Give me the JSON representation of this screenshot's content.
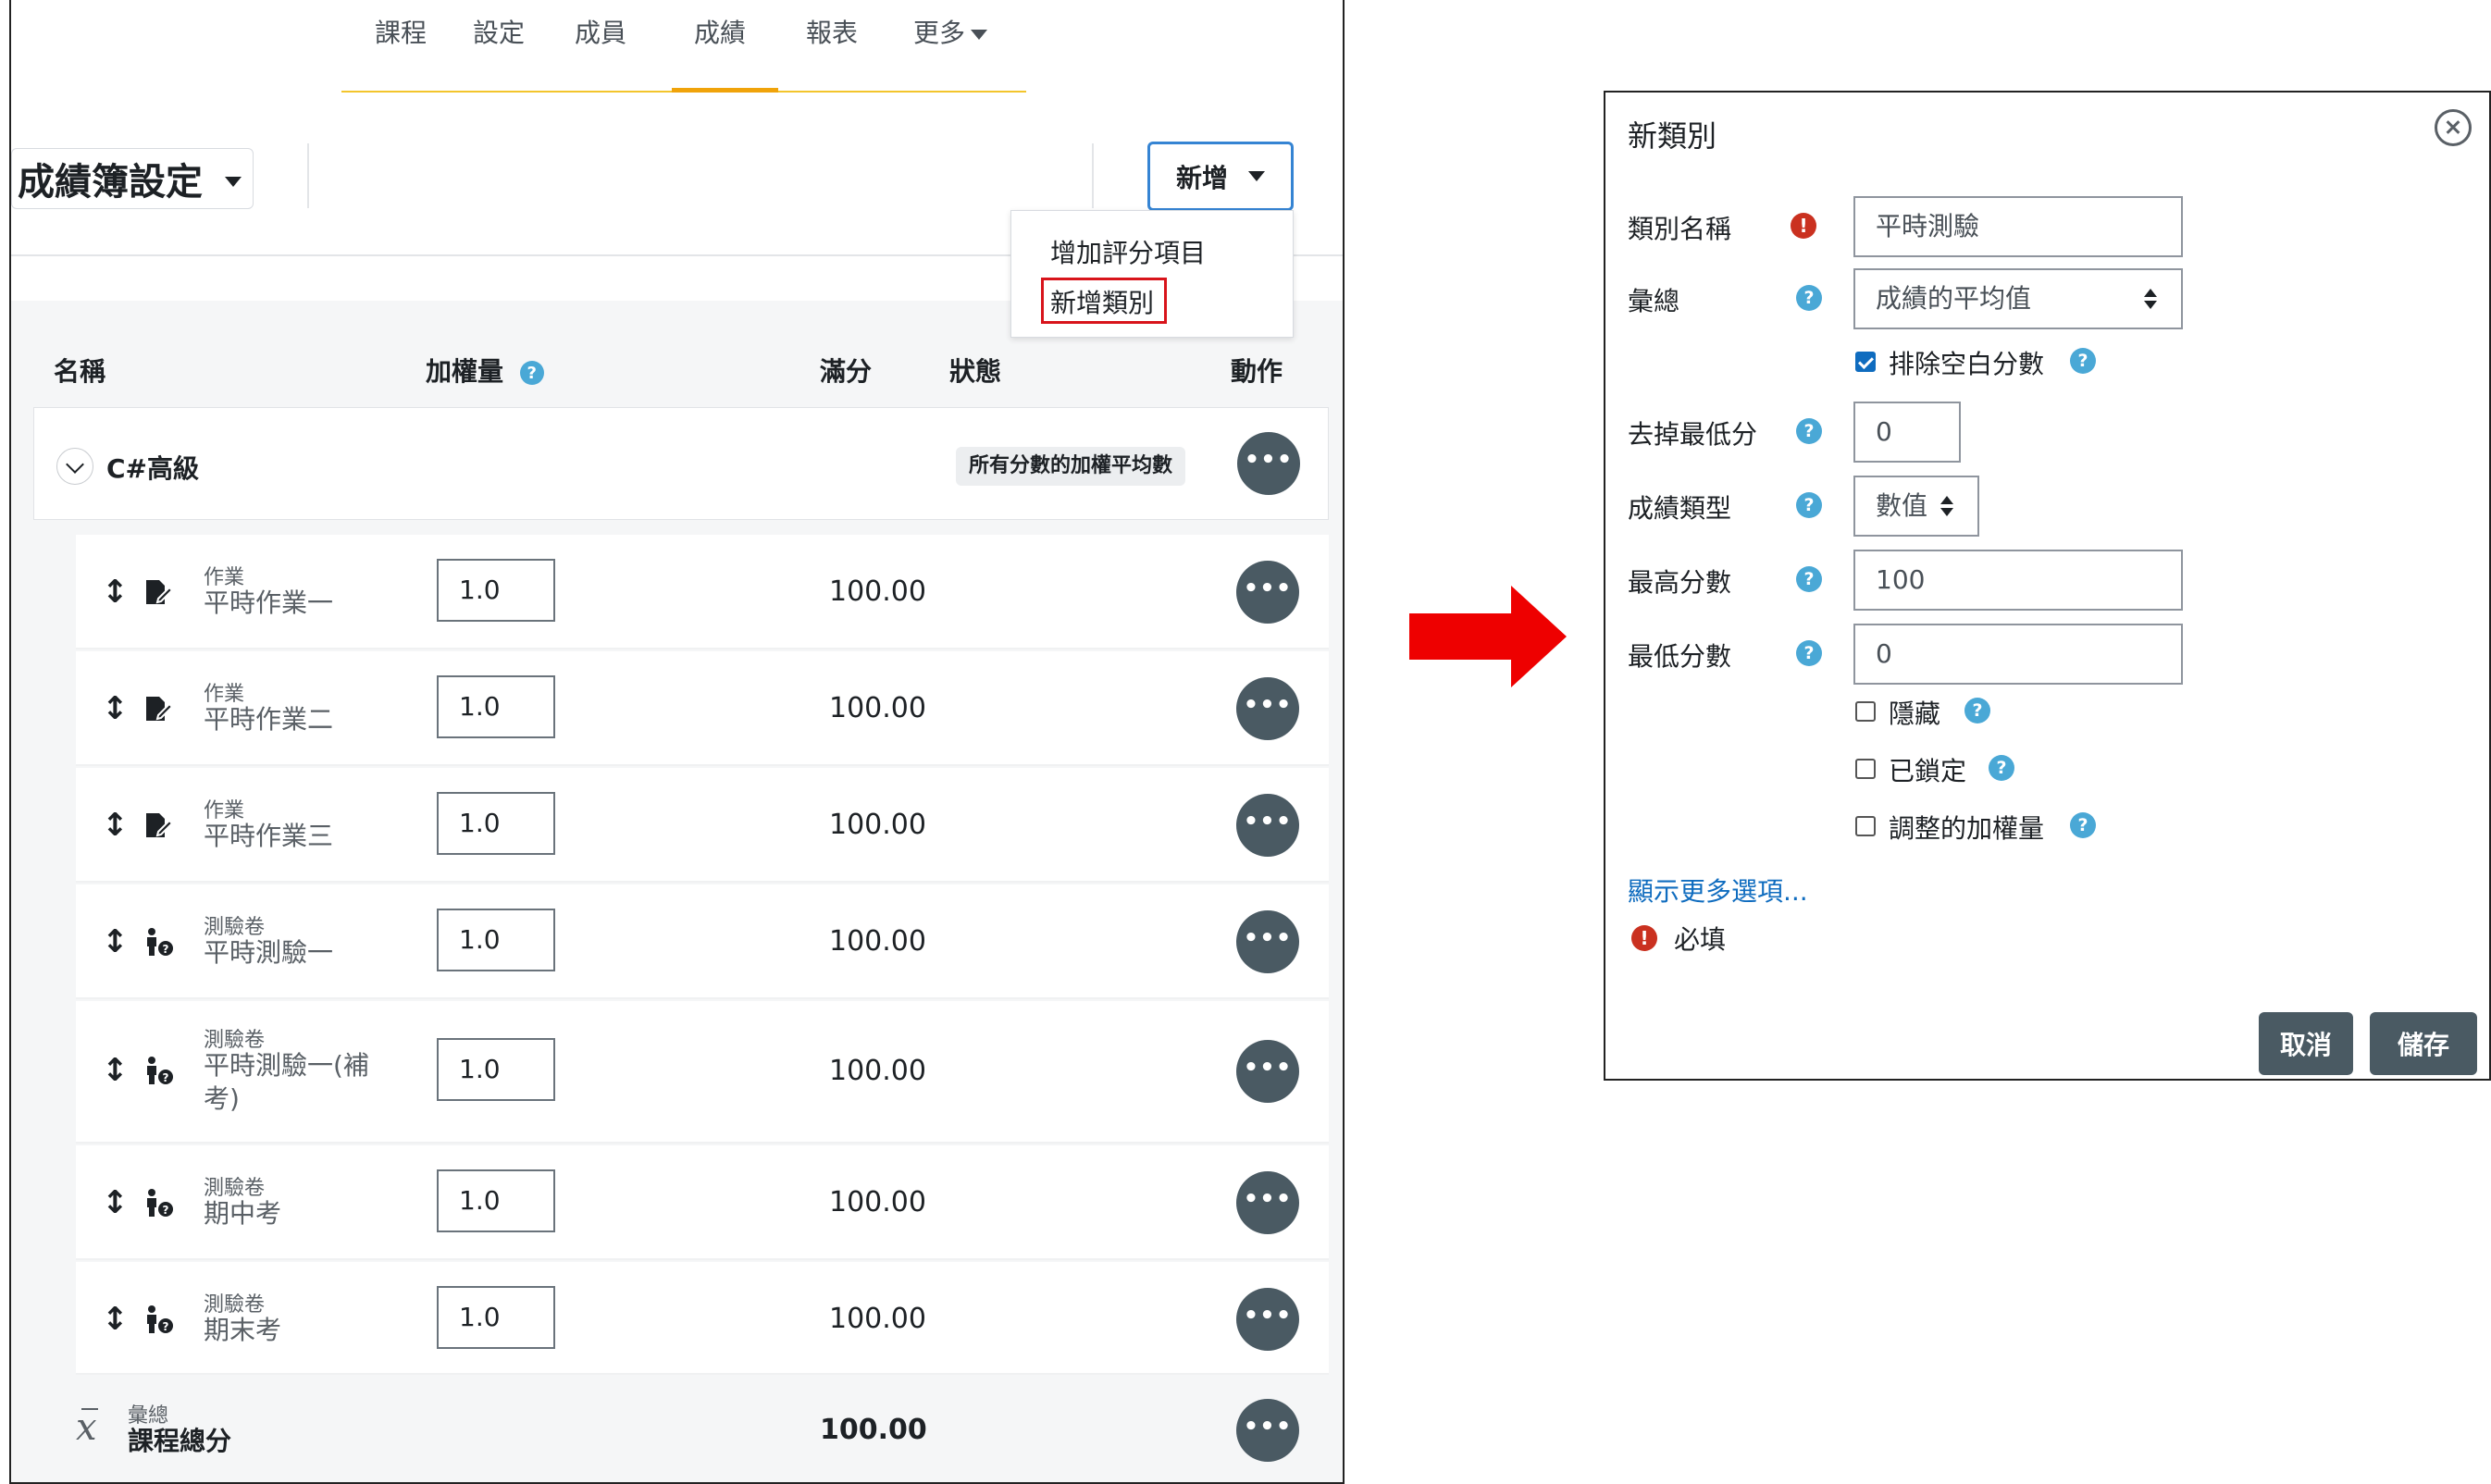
{
  "nav": {
    "items": [
      "課程",
      "設定",
      "成員",
      "成績",
      "報表",
      "更多"
    ]
  },
  "header": {
    "title": "成績簿設定",
    "add_button": "新增",
    "dropdown": [
      "增加評分項目",
      "新增類別"
    ]
  },
  "table": {
    "columns": {
      "name": "名稱",
      "weight": "加權量",
      "max": "滿分",
      "status": "狀態",
      "actions": "動作"
    },
    "category": {
      "name": "C#高級",
      "aggregation": "所有分數的加權平均數"
    },
    "items": [
      {
        "type": "作業",
        "name": "平時作業一",
        "weight": "1.0",
        "max": "100.00"
      },
      {
        "type": "作業",
        "name": "平時作業二",
        "weight": "1.0",
        "max": "100.00"
      },
      {
        "type": "作業",
        "name": "平時作業三",
        "weight": "1.0",
        "max": "100.00"
      },
      {
        "type": "測驗卷",
        "name": "平時測驗一",
        "weight": "1.0",
        "max": "100.00"
      },
      {
        "type": "測驗卷",
        "name": "平時測驗一(補考)",
        "weight": "1.0",
        "max": "100.00"
      },
      {
        "type": "測驗卷",
        "name": "期中考",
        "weight": "1.0",
        "max": "100.00"
      },
      {
        "type": "測驗卷",
        "name": "期末考",
        "weight": "1.0",
        "max": "100.00"
      }
    ],
    "total": {
      "type": "彙總",
      "name": "課程總分",
      "max": "100.00",
      "symbol": "x"
    },
    "more_glyph": "•••"
  },
  "dialog": {
    "title": "新類別",
    "fields": {
      "category_name": {
        "label": "類別名稱",
        "value": "平時測驗"
      },
      "aggregation": {
        "label": "彙總",
        "value": "成績的平均值"
      },
      "exclude_empty": {
        "label": "排除空白分數",
        "checked": true
      },
      "drop_lowest": {
        "label": "去掉最低分",
        "value": "0"
      },
      "grade_type": {
        "label": "成績類型",
        "value": "數值"
      },
      "max_grade": {
        "label": "最高分數",
        "value": "100"
      },
      "min_grade": {
        "label": "最低分數",
        "value": "0"
      },
      "hidden": {
        "label": "隱藏",
        "checked": false
      },
      "locked": {
        "label": "已鎖定",
        "checked": false
      },
      "weight_adjusted": {
        "label": "調整的加權量",
        "checked": false
      }
    },
    "more_options": "顯示更多選項...",
    "required_note": "必填",
    "cancel": "取消",
    "save": "儲存",
    "help_glyph": "?",
    "required_glyph": "!"
  },
  "colors": {
    "accent": "#f0a30a",
    "primary": "#3584d3",
    "arrow": "#ee0000",
    "highlight_box": "#d8141b",
    "dark_button": "#4a5a63",
    "help": "#4aa8d6",
    "required": "#ca3120"
  }
}
